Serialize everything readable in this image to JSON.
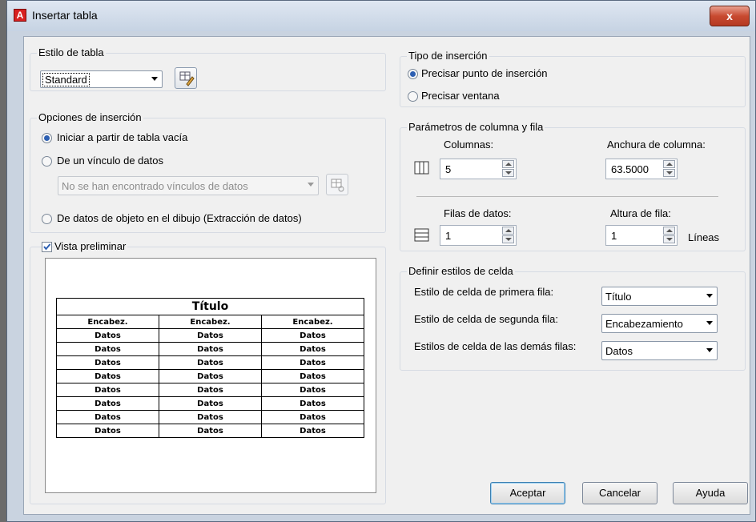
{
  "window": {
    "title": "Insertar tabla",
    "close_label": "x"
  },
  "estilo_tabla": {
    "legend": "Estilo de tabla",
    "value": "Standard"
  },
  "opciones_insercion": {
    "legend": "Opciones de inserción",
    "opt1": "Iniciar a partir de tabla vacía",
    "opt2": "De un vínculo de datos",
    "link_placeholder": "No se han encontrado vínculos de datos",
    "opt3": "De datos de objeto en el dibujo (Extracción de datos)"
  },
  "vista_preliminar": {
    "label": "Vista preliminar",
    "checked": true,
    "table": {
      "title": "Título",
      "headers": [
        "Encabez.",
        "Encabez.",
        "Encabez."
      ],
      "rows": [
        [
          "Datos",
          "Datos",
          "Datos"
        ],
        [
          "Datos",
          "Datos",
          "Datos"
        ],
        [
          "Datos",
          "Datos",
          "Datos"
        ],
        [
          "Datos",
          "Datos",
          "Datos"
        ],
        [
          "Datos",
          "Datos",
          "Datos"
        ],
        [
          "Datos",
          "Datos",
          "Datos"
        ],
        [
          "Datos",
          "Datos",
          "Datos"
        ],
        [
          "Datos",
          "Datos",
          "Datos"
        ]
      ]
    }
  },
  "tipo_insercion": {
    "legend": "Tipo de inserción",
    "opt1": "Precisar punto de inserción",
    "opt2": "Precisar ventana"
  },
  "parametros": {
    "legend": "Parámetros de columna y fila",
    "columnas_label": "Columnas:",
    "columnas_value": "5",
    "anchura_label": "Anchura de columna:",
    "anchura_value": "63.5000",
    "filas_label": "Filas de datos:",
    "filas_value": "1",
    "altura_label": "Altura de fila:",
    "altura_value": "1",
    "lineas_label": "Líneas"
  },
  "estilos_celda": {
    "legend": "Definir estilos de celda",
    "primera_label": "Estilo de celda de primera fila:",
    "primera_value": "Título",
    "segunda_label": "Estilo de celda de segunda fila:",
    "segunda_value": "Encabezamiento",
    "demas_label": "Estilos de celda de las demás filas:",
    "demas_value": "Datos"
  },
  "buttons": {
    "aceptar": "Aceptar",
    "cancelar": "Cancelar",
    "ayuda": "Ayuda"
  }
}
